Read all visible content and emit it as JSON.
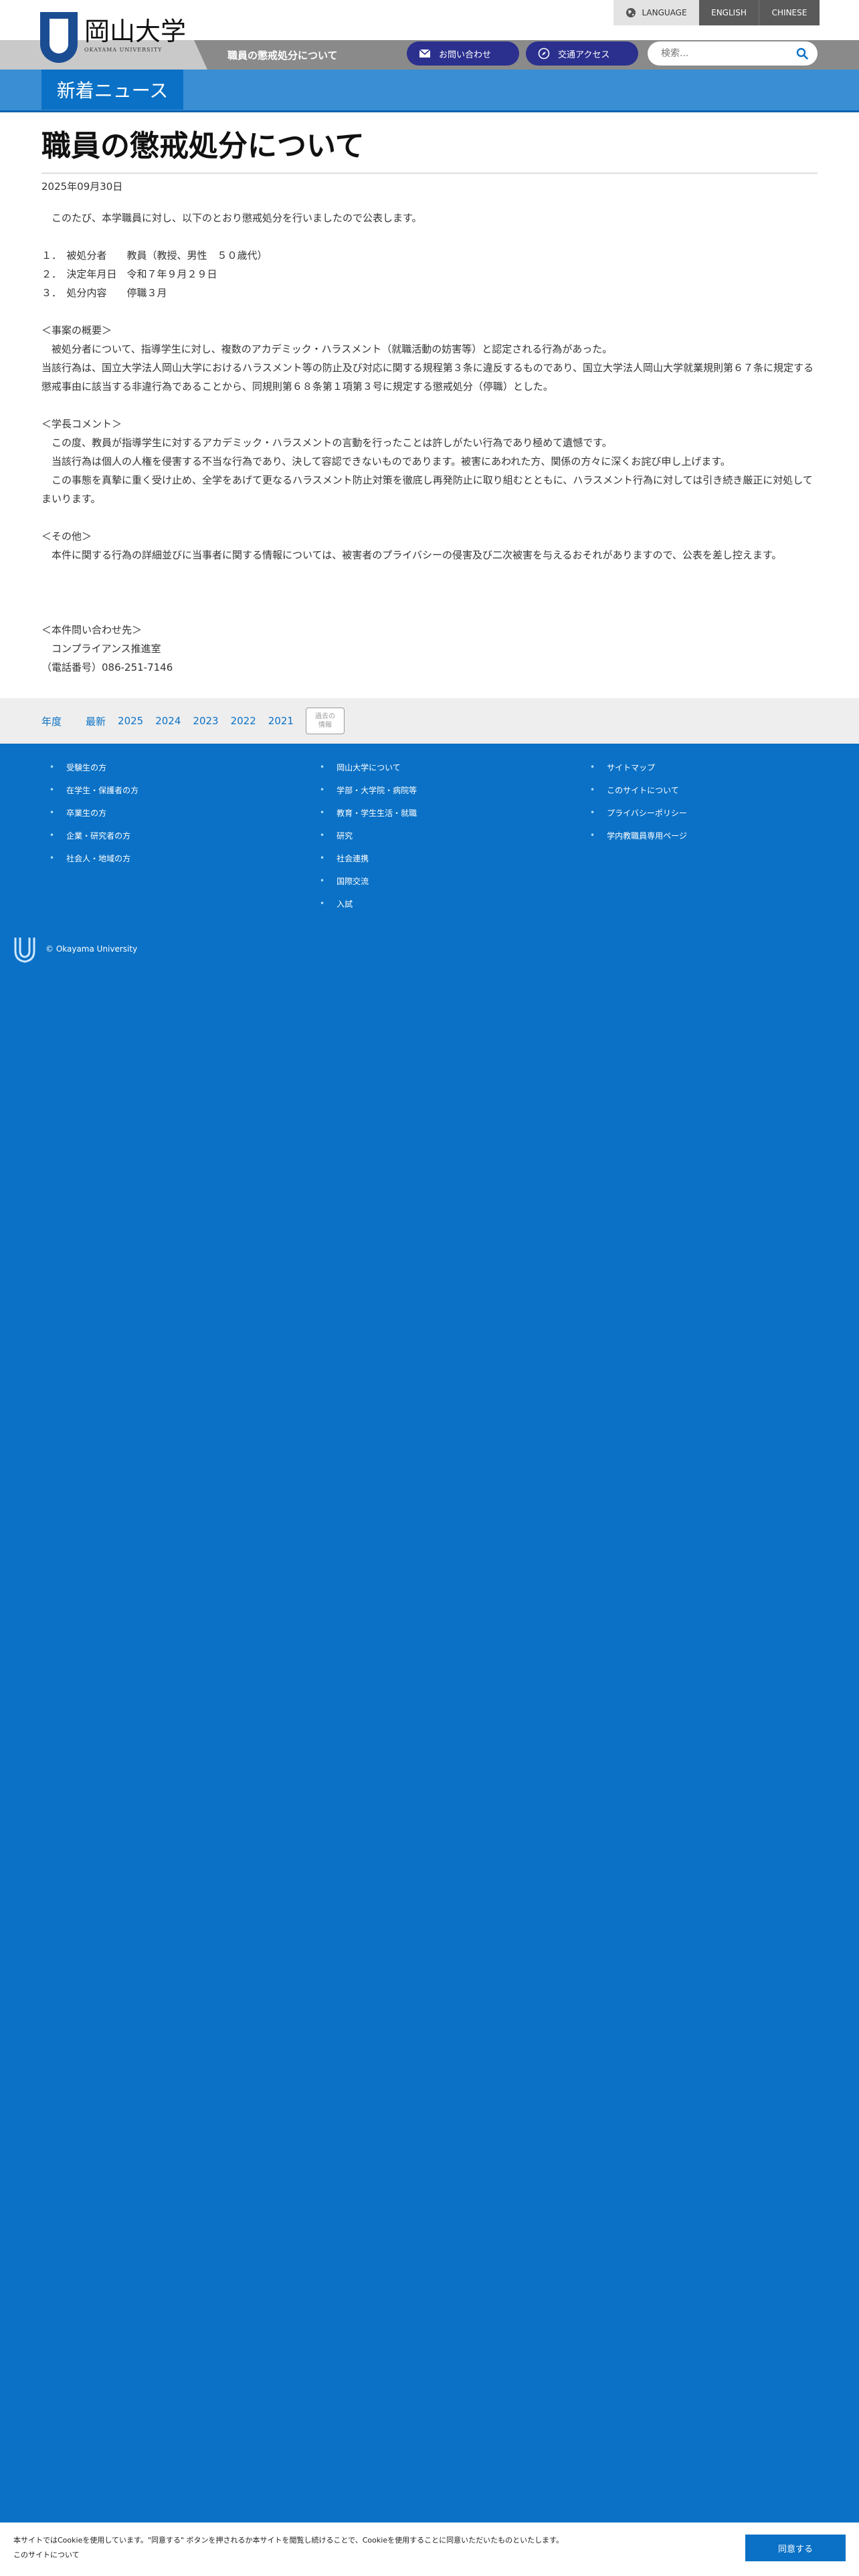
{
  "language_bar": {
    "label": "LANGUAGE",
    "english": "ENGLISH",
    "chinese": "CHINESE"
  },
  "header": {
    "logo_text": "岡山大学",
    "logo_sub": "OKAYAMA UNIVERSITY",
    "breadcrumb_title": "職員の懲戒処分について",
    "contact_label": "お問い合わせ",
    "access_label": "交通アクセス",
    "search_placeholder": "検索..."
  },
  "section": {
    "tab_label": "新着ニュース"
  },
  "article": {
    "title": "職員の懲戒処分について",
    "date": "2025年09月30日",
    "paragraphs": [
      "　このたび、本学職員に対し、以下のとおり懲戒処分を行いましたので公表します。",
      "",
      "１．　被処分者　　教員（教授、男性　５０歳代）",
      "２．　決定年月日　令和７年９月２９日",
      "３．　処分内容　　停職３月",
      "",
      "＜事案の概要＞",
      "　被処分者について、指導学生に対し、複数のアカデミック・ハラスメント（就職活動の妨害等）と認定される行為があった。",
      "当該行為は、国立大学法人岡山大学におけるハラスメント等の防止及び対応に関する規程第３条に違反するものであり、国立大学法人岡山大学就業規則第６７条に規定する懲戒事由に該当する非違行為であることから、同規則第６８条第１項第３号に規定する懲戒処分（停職）とした。",
      "",
      "＜学長コメント＞",
      "　この度、教員が指導学生に対するアカデミック・ハラスメントの言動を行ったことは許しがたい行為であり極めて遺憾です。",
      "　当該行為は個人の人権を侵害する不当な行為であり、決して容認できないものであります。被害にあわれた方、関係の方々に深くお詫び申し上げます。",
      "　この事態を真摯に重く受け止め、全学をあげて更なるハラスメント防止対策を徹底し再発防止に取り組むとともに、ハラスメント行為に対しては引き続き厳正に対処してまいります。",
      "",
      "＜その他＞",
      "　本件に関する行為の詳細並びに当事者に関する情報については、被害者のプライバシーの侵害及び二次被害を与えるおそれがありますので、公表を差し控えます。",
      "",
      "",
      "",
      "＜本件問い合わせ先＞",
      "　コンプライアンス推進室",
      "（電話番号）086-251-7146"
    ]
  },
  "year_filter": {
    "label": "年度",
    "items": [
      "最新",
      "2025",
      "2024",
      "2023",
      "2022",
      "2021"
    ],
    "past_info_line1": "過去の",
    "past_info_line2": "情報"
  },
  "footer": {
    "col1": [
      "受験生の方",
      "在学生・保護者の方",
      "卒業生の方",
      "企業・研究者の方",
      "社会人・地域の方"
    ],
    "col2": [
      "岡山大学について",
      "学部・大学院・病院等",
      "教育・学生生活・就職",
      "研究",
      "社会連携",
      "国際交流",
      "入試"
    ],
    "col3": [
      "サイトマップ",
      "このサイトについて",
      "プライバシーポリシー",
      "学内教職員専用ページ"
    ],
    "copyright": "© Okayama University"
  },
  "cookie": {
    "text": "本サイトではCookieを使用しています。\"同意する\" ボタンを押されるか本サイトを閲覧し続けることで、Cookieを使用することに同意いただいたものといたします。",
    "link": "このサイトについて",
    "agree_label": "同意する"
  },
  "colors": {
    "brand_blue": "#0a71c6",
    "navy_pill": "#2b2f8e"
  }
}
